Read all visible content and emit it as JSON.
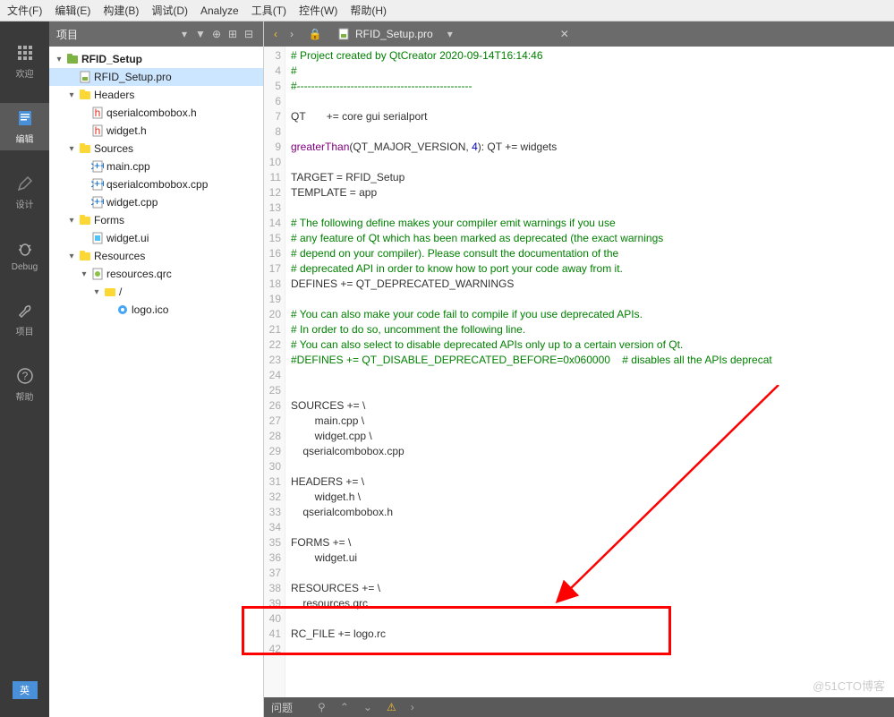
{
  "menu": {
    "file": "文件(F)",
    "edit": "编辑(E)",
    "build": "构建(B)",
    "debug": "调试(D)",
    "analyze": "Analyze",
    "tools": "工具(T)",
    "widgets": "控件(W)",
    "help": "帮助(H)"
  },
  "sidebar": {
    "welcome": "欢迎",
    "edit": "编辑",
    "design": "设计",
    "debug": "Debug",
    "project": "项目",
    "help": "帮助",
    "lang": "英"
  },
  "projHeader": "项目",
  "tree": {
    "root": "RFID_Setup",
    "pro": "RFID_Setup.pro",
    "headers": "Headers",
    "h1": "qserialcombobox.h",
    "h2": "widget.h",
    "sources": "Sources",
    "s1": "main.cpp",
    "s2": "qserialcombobox.cpp",
    "s3": "widget.cpp",
    "forms": "Forms",
    "f1": "widget.ui",
    "resources": "Resources",
    "r1": "resources.qrc",
    "r2": "/",
    "r3": "logo.ico"
  },
  "tab": "RFID_Setup.pro",
  "code": {
    "l3": "# Project created by QtCreator 2020-09-14T16:14:46",
    "l4": "#",
    "l5": "#-------------------------------------------------",
    "l7": "QT       += core gui serialport",
    "l9a": "greaterThan",
    "l9b": "(QT_MAJOR_VERSION, ",
    "l9c": "4",
    "l9d": "): QT += widgets",
    "l11": "TARGET = RFID_Setup",
    "l12": "TEMPLATE = app",
    "l14": "# The following define makes your compiler emit warnings if you use",
    "l15": "# any feature of Qt which has been marked as deprecated (the exact warnings",
    "l16": "# depend on your compiler). Please consult the documentation of the",
    "l17": "# deprecated API in order to know how to port your code away from it.",
    "l18": "DEFINES += QT_DEPRECATED_WARNINGS",
    "l20": "# You can also make your code fail to compile if you use deprecated APIs.",
    "l21": "# In order to do so, uncomment the following line.",
    "l22": "# You can also select to disable deprecated APIs only up to a certain version of Qt.",
    "l23": "#DEFINES += QT_DISABLE_DEPRECATED_BEFORE=0x060000    # disables all the APIs deprecat",
    "l26": "SOURCES += \\",
    "l27": "        main.cpp \\",
    "l28": "        widget.cpp \\",
    "l29": "    qserialcombobox.cpp",
    "l31": "HEADERS += \\",
    "l32": "        widget.h \\",
    "l33": "    qserialcombobox.h",
    "l35": "FORMS += \\",
    "l36": "        widget.ui",
    "l38": "RESOURCES += \\",
    "l39": "    resources.qrc",
    "l41": "RC_FILE += logo.rc"
  },
  "status": {
    "issues": "问题"
  },
  "watermark": "@51CTO博客"
}
